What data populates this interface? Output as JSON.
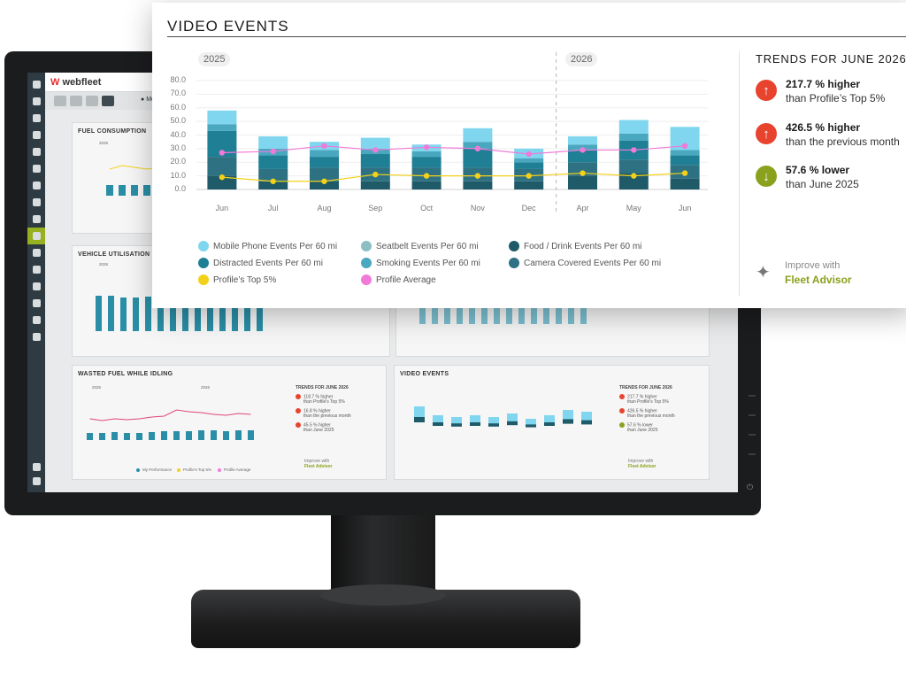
{
  "colors": {
    "mobile_phone": "#7fd6ee",
    "seatbelt": "#8bbfc4",
    "food_drink": "#1f5a68",
    "distracted": "#1f7f95",
    "smoking": "#4aa7c0",
    "camera_covered": "#2e7182",
    "top5": "#f3d11a",
    "profile_avg": "#f07ad8",
    "trend_up": "#e8432c",
    "trend_down": "#8aa11d",
    "brand_accent": "#96b020"
  },
  "app": {
    "brand": "webfleet",
    "period": "Monthly",
    "sidebar_icons": [
      "grid-icon",
      "car-icon",
      "truck-icon",
      "driver-icon",
      "chat-icon",
      "document-icon",
      "warning-icon",
      "camera-icon",
      "wrench-icon",
      "chart-icon",
      "fuel-icon",
      "box-icon",
      "building-icon",
      "shield-icon",
      "person-icon",
      "group-icon",
      "settings-icon",
      "menu-icon"
    ]
  },
  "cards": {
    "fuel": {
      "title": "FUEL CONSUMPTION",
      "year": "2025"
    },
    "vehicle": {
      "title": "VEHICLE UTILISATION",
      "year": "2026"
    },
    "wasted": {
      "title": "WASTED FUEL WHILE IDLING",
      "year1": "2025",
      "year2": "2026",
      "trends_title": "TRENDS FOR JUNE 2026",
      "trends": [
        {
          "value": "118.7 % higher",
          "label": "than Profile's Top 5%"
        },
        {
          "value": "16.8 % higher",
          "label": "than the previous month"
        },
        {
          "value": "45.5 % higher",
          "label": "than June 2025"
        }
      ],
      "legend": [
        "My Performance",
        "Profile's Top 5%",
        "Profile Average"
      ],
      "advisor_hint": "Improve with",
      "advisor_link": "Fleet Advisor"
    },
    "video_small": {
      "title": "VIDEO EVENTS",
      "trends_title": "TRENDS FOR JUNE 2026",
      "trends": [
        {
          "value": "217.7 % higher",
          "label": "than Profile's Top 5%"
        },
        {
          "value": "426.5 % higher",
          "label": "than the previous month"
        },
        {
          "value": "57.6 % lower",
          "label": "than June 2025"
        }
      ],
      "advisor_hint": "Improve with",
      "advisor_link": "Fleet Advisor"
    }
  },
  "popup": {
    "title": "VIDEO EVENTS",
    "year_left": "2025",
    "year_right": "2026",
    "trends_title": "TRENDS FOR JUNE 2026",
    "trends": [
      {
        "direction": "up",
        "value": "217.7 % higher",
        "label": "than Profile’s Top 5%"
      },
      {
        "direction": "up",
        "value": "426.5 % higher",
        "label": "than the previous month"
      },
      {
        "direction": "down",
        "value": "57.6 % lower",
        "label": "than June 2025"
      }
    ],
    "advisor_hint": "Improve with",
    "advisor_link": "Fleet Advisor"
  },
  "chart_data": {
    "type": "bar",
    "stacked": true,
    "categories": [
      "Jun",
      "Jul",
      "Aug",
      "Sep",
      "Oct",
      "Nov",
      "Dec",
      "Apr",
      "May",
      "Jun"
    ],
    "y_ticks": [
      "0.0",
      "10.0",
      "20.0",
      "30.0",
      "40.0",
      "50.0",
      "60.0",
      "70.0",
      "80.0"
    ],
    "ylim": [
      0,
      80
    ],
    "grid": true,
    "series": [
      {
        "name": "Food / Drink Events Per 60 mi",
        "color_key": "food_drink",
        "values": [
          10,
          6,
          6,
          6,
          6,
          6,
          6,
          10,
          12,
          8
        ]
      },
      {
        "name": "Camera Covered Events Per 60 mi",
        "color_key": "camera_covered",
        "values": [
          14,
          9,
          10,
          10,
          10,
          10,
          9,
          10,
          10,
          10
        ]
      },
      {
        "name": "Distracted Events Per 60 mi",
        "color_key": "distracted",
        "values": [
          19,
          10,
          8,
          10,
          8,
          14,
          5,
          9,
          14,
          7
        ]
      },
      {
        "name": "Smoking Events Per 60 mi",
        "color_key": "smoking",
        "values": [
          5,
          5,
          5,
          4,
          4,
          5,
          3,
          4,
          5,
          4
        ]
      },
      {
        "name": "Seatbelt Events Per 60 mi",
        "color_key": "seatbelt",
        "values": [
          0,
          0,
          0,
          0,
          0,
          0,
          0,
          0,
          0,
          0
        ]
      },
      {
        "name": "Mobile Phone Events Per 60 mi",
        "color_key": "mobile_phone",
        "values": [
          10,
          9,
          6,
          8,
          5,
          10,
          7,
          6,
          10,
          17
        ]
      }
    ],
    "lines": [
      {
        "name": "Profile's Top 5%",
        "color_key": "top5",
        "values": [
          9,
          6,
          6,
          11,
          10,
          10,
          10,
          12,
          10,
          12
        ]
      },
      {
        "name": "Profile Average",
        "color_key": "profile_avg",
        "values": [
          27,
          28,
          32,
          29,
          31,
          30,
          26,
          29,
          29,
          32
        ]
      }
    ],
    "legend": [
      {
        "name": "Mobile Phone Events Per 60 mi",
        "color_key": "mobile_phone"
      },
      {
        "name": "Seatbelt Events Per 60 mi",
        "color_key": "seatbelt"
      },
      {
        "name": "Food / Drink Events Per 60 mi",
        "color_key": "food_drink"
      },
      {
        "name": "Distracted Events Per 60 mi",
        "color_key": "distracted"
      },
      {
        "name": "Smoking Events Per 60 mi",
        "color_key": "smoking"
      },
      {
        "name": "Camera Covered Events Per 60 mi",
        "color_key": "camera_covered"
      },
      {
        "name": "Profile’s Top 5%",
        "color_key": "top5"
      },
      {
        "name": "Profile Average",
        "color_key": "profile_avg"
      }
    ]
  }
}
